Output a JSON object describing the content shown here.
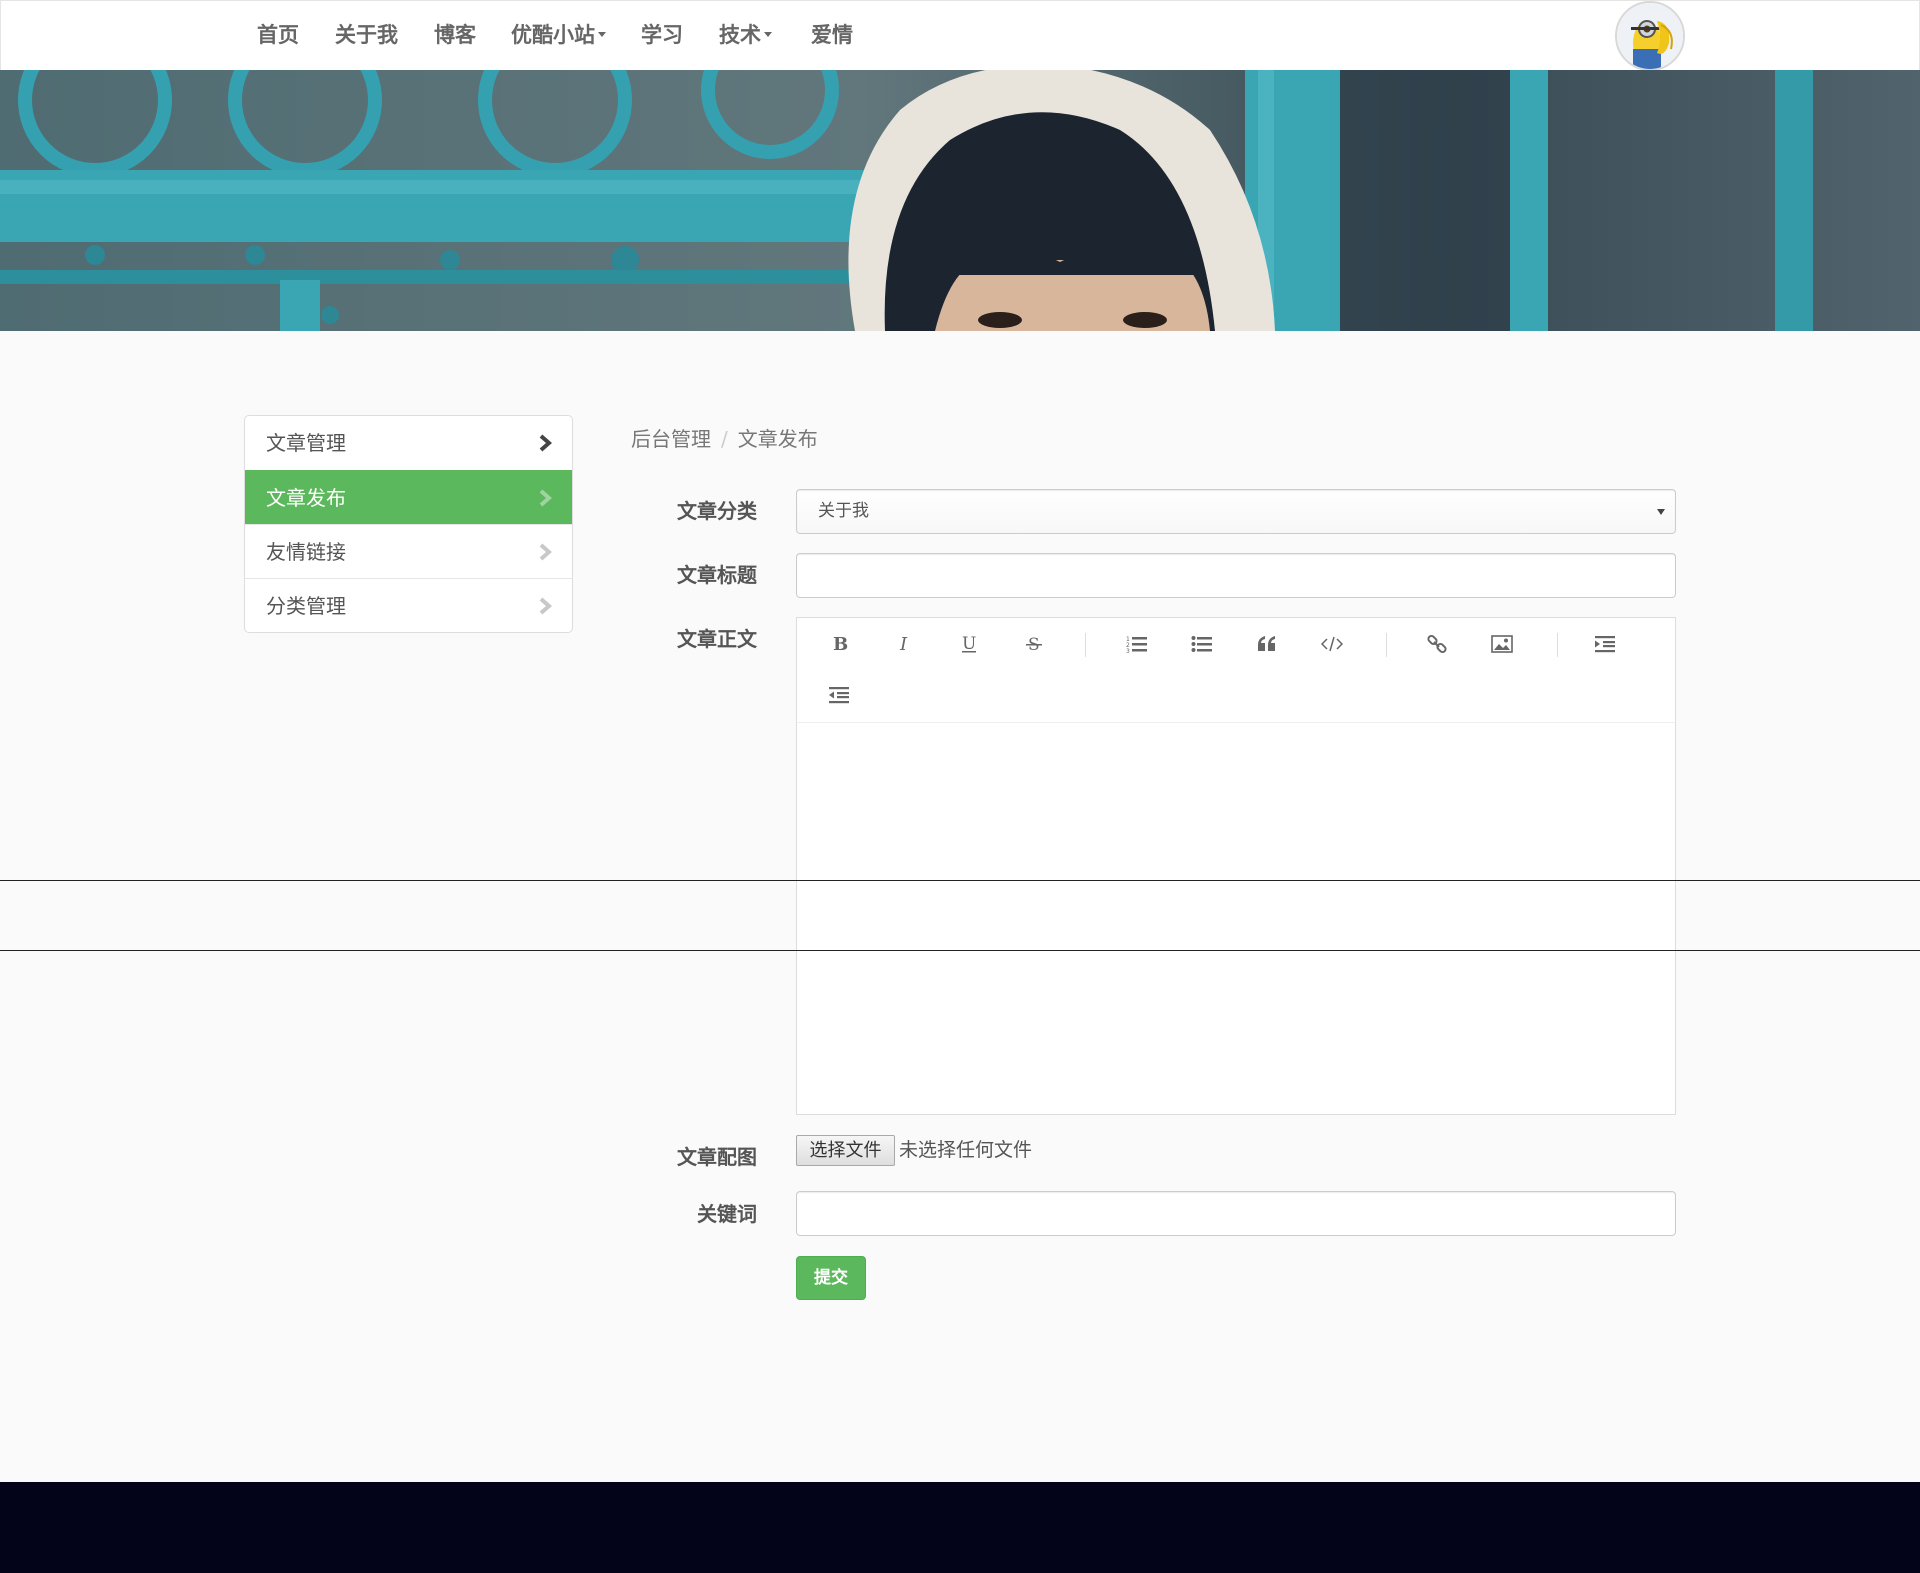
{
  "nav": {
    "items": [
      {
        "label": "首页",
        "dropdown": false
      },
      {
        "label": "关于我",
        "dropdown": false
      },
      {
        "label": "博客",
        "dropdown": false
      },
      {
        "label": "优酷小站",
        "dropdown": true
      },
      {
        "label": "学习",
        "dropdown": false
      },
      {
        "label": "技术",
        "dropdown": true
      },
      {
        "label": "爱情",
        "dropdown": false
      }
    ]
  },
  "sidebar": {
    "items": [
      {
        "label": "文章管理",
        "active": false
      },
      {
        "label": "文章发布",
        "active": true
      },
      {
        "label": "友情链接",
        "active": false
      },
      {
        "label": "分类管理",
        "active": false
      }
    ]
  },
  "breadcrumb": {
    "items": [
      "后台管理",
      "文章发布"
    ],
    "separator": "/"
  },
  "form": {
    "category_label": "文章分类",
    "category_value": "关于我",
    "title_label": "文章标题",
    "title_value": "",
    "body_label": "文章正文",
    "image_label": "文章配图",
    "file_button": "选择文件",
    "file_status": "未选择任何文件",
    "keywords_label": "关键词",
    "keywords_value": "",
    "submit_label": "提交"
  },
  "editor_toolbar": {
    "buttons": [
      "bold-icon",
      "italic-icon",
      "underline-icon",
      "strikethrough-icon",
      "ordered-list-icon",
      "unordered-list-icon",
      "blockquote-icon",
      "code-icon",
      "link-icon",
      "image-icon",
      "indent-icon",
      "outdent-icon"
    ]
  },
  "colors": {
    "accent": "#5cb85c",
    "footer": "#03031a",
    "banner_gate": "#3aa6b4"
  }
}
